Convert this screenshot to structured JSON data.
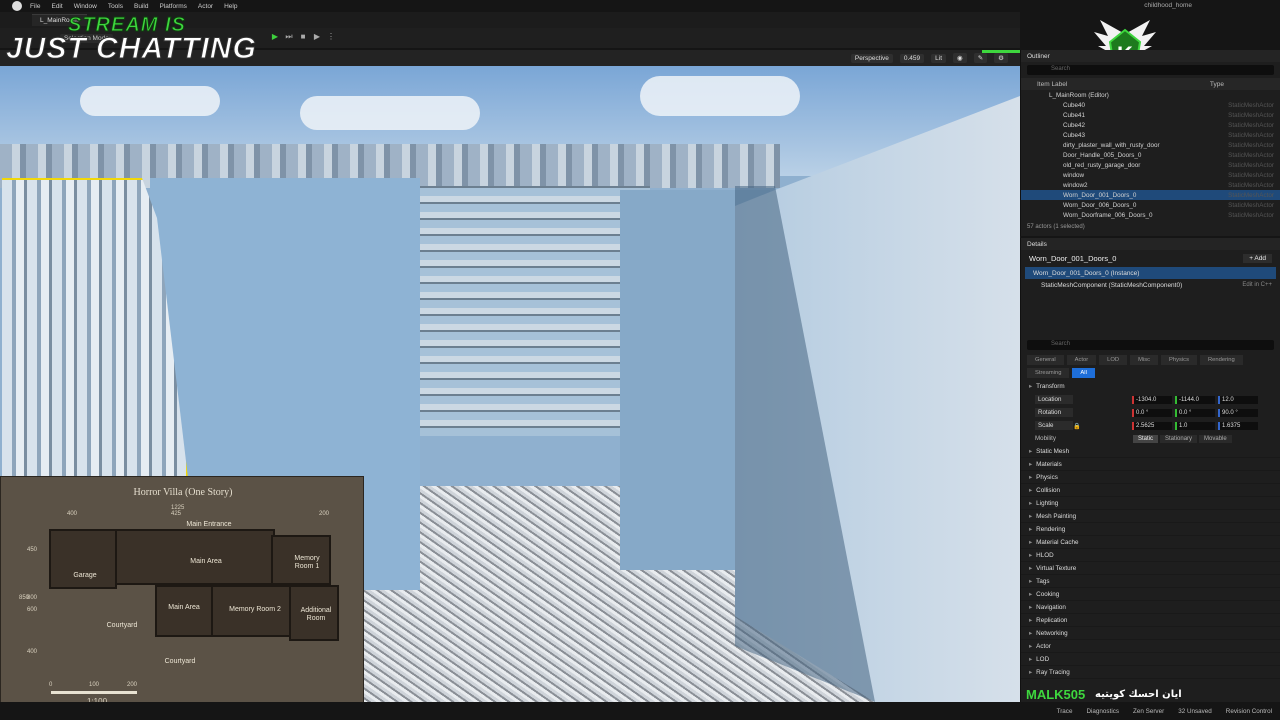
{
  "menu": {
    "items": [
      "File",
      "Edit",
      "Window",
      "Tools",
      "Build",
      "Platforms",
      "Actor",
      "Help"
    ],
    "project": "childhood_home"
  },
  "tabs": {
    "level": "L_MainRoom"
  },
  "toolbar": {
    "selection_mode": "Selection Mode"
  },
  "viewport": {
    "perspective": "Perspective",
    "speed": "0.459",
    "lit": "Lit"
  },
  "overlay": {
    "stream_line1": "STREAM IS",
    "stream_line2": "JUST CHATTING",
    "logo_letter": "K",
    "chat_user": "MALK505",
    "chat_message": "ايان احسك كويتيه"
  },
  "map": {
    "title": "Horror Villa (One Story)",
    "rooms": {
      "main_entrance": "Main Entrance",
      "garage": "Garage",
      "main_area_top": "Main Area",
      "memory_room_1": "Memory Room 1",
      "main_area": "Main Area",
      "memory_room_2": "Memory Room 2",
      "additional_room": "Additional Room",
      "courtyard_left": "Courtyard",
      "courtyard_bottom": "Courtyard"
    },
    "dims": {
      "d1": "400",
      "d2": "1225",
      "d3": "425",
      "d4": "200",
      "d5": "450",
      "d6": "800",
      "d7": "850",
      "d8": "400",
      "d9": "600",
      "d10": "400"
    },
    "scale": {
      "zero": "0",
      "hundred": "100",
      "twohundred": "200",
      "ratio": "1:100"
    }
  },
  "outliner": {
    "title": "Outliner",
    "search_placeholder": "Search",
    "col_label": "Item Label",
    "col_type": "Type",
    "level_row": "L_MainRoom (Editor)",
    "rows": [
      {
        "label": "Cube40",
        "type": "StaticMeshActor"
      },
      {
        "label": "Cube41",
        "type": "StaticMeshActor"
      },
      {
        "label": "Cube42",
        "type": "StaticMeshActor"
      },
      {
        "label": "Cube43",
        "type": "StaticMeshActor"
      },
      {
        "label": "dirty_plaster_wall_with_rusty_door",
        "type": "StaticMeshActor"
      },
      {
        "label": "Door_Handle_005_Doors_0",
        "type": "StaticMeshActor"
      },
      {
        "label": "old_red_rusty_garage_door",
        "type": "StaticMeshActor"
      },
      {
        "label": "window",
        "type": "StaticMeshActor"
      },
      {
        "label": "window2",
        "type": "StaticMeshActor"
      },
      {
        "label": "Worn_Door_001_Doors_0",
        "type": "StaticMeshActor"
      },
      {
        "label": "Worn_Door_006_Doors_0",
        "type": "StaticMeshActor"
      },
      {
        "label": "Worn_Doorframe_006_Doors_0",
        "type": "StaticMeshActor"
      }
    ],
    "count": "57 actors (1 selected)"
  },
  "details": {
    "title": "Details",
    "actor_name": "Worn_Door_001_Doors_0",
    "add_label": "+ Add",
    "instance_row": "Worn_Door_001_Doors_0 (Instance)",
    "component_row": "StaticMeshComponent (StaticMeshComponent0)",
    "edit_cpp": "Edit in C++",
    "search_placeholder": "Search",
    "filter_tabs": [
      "General",
      "Actor",
      "LOD",
      "Misc",
      "Physics",
      "Rendering",
      "Streaming",
      "All"
    ],
    "transform_label": "Transform",
    "location": {
      "label": "Location",
      "x": "-1304.0",
      "y": "-1144.0",
      "z": "12.0"
    },
    "rotation": {
      "label": "Rotation",
      "x": "0.0 °",
      "y": "0.0 °",
      "z": "90.0 °"
    },
    "scale": {
      "label": "Scale",
      "x": "2.5625",
      "y": "1.0",
      "z": "1.6375"
    },
    "mobility_label": "Mobility",
    "mobility": [
      "Static",
      "Stationary",
      "Movable"
    ],
    "sections": [
      "Static Mesh",
      "Materials",
      "Physics",
      "Collision",
      "Lighting",
      "Mesh Painting",
      "Rendering",
      "Material Cache",
      "HLOD",
      "Virtual Texture",
      "Tags",
      "Cooking",
      "Navigation",
      "Replication",
      "Networking",
      "Actor",
      "LOD",
      "Ray Tracing"
    ]
  },
  "status": {
    "trace": "Trace",
    "diagnostics": "Diagnostics",
    "zen": "Zen Server",
    "unsaved": "32 Unsaved",
    "revision": "Revision Control"
  }
}
